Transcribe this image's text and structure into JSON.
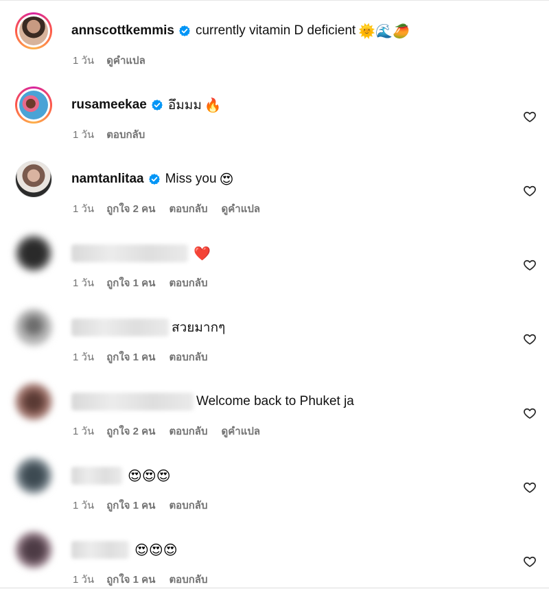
{
  "comments": [
    {
      "username": "annscottkemmis",
      "verified": true,
      "text": "currently vitamin D deficient",
      "emoji": "🌞🌊🥭",
      "time": "1 วัน",
      "likes": "",
      "reply": "",
      "translate": "ดูคำแปล",
      "has_heart": false
    },
    {
      "username": "rusameekae",
      "verified": true,
      "text": "อึมมม",
      "emoji": "🔥",
      "time": "1 วัน",
      "likes": "",
      "reply": "ตอบกลับ",
      "translate": "",
      "has_heart": true
    },
    {
      "username": "namtanlitaa",
      "verified": true,
      "text": "Miss you",
      "emoji": "😍",
      "time": "1 วัน",
      "likes": "ถูกใจ 2 คน",
      "reply": "ตอบกลับ",
      "translate": "ดูคำแปล",
      "has_heart": true
    },
    {
      "username": "",
      "verified": false,
      "text": "",
      "emoji": "❤️",
      "time": "1 วัน",
      "likes": "ถูกใจ 1 คน",
      "reply": "ตอบกลับ",
      "translate": "",
      "has_heart": true
    },
    {
      "username": "",
      "verified": false,
      "text": "สวยมากๆ",
      "emoji": "",
      "time": "1 วัน",
      "likes": "ถูกใจ 1 คน",
      "reply": "ตอบกลับ",
      "translate": "",
      "has_heart": true
    },
    {
      "username": "",
      "verified": false,
      "text": "Welcome back to Phuket ja",
      "emoji": "",
      "time": "1 วัน",
      "likes": "ถูกใจ 2 คน",
      "reply": "ตอบกลับ",
      "translate": "ดูคำแปล",
      "has_heart": true
    },
    {
      "username": "",
      "verified": false,
      "text": "",
      "emoji": "😍😍😍",
      "time": "1 วัน",
      "likes": "ถูกใจ 1 คน",
      "reply": "ตอบกลับ",
      "translate": "",
      "has_heart": true
    },
    {
      "username": "",
      "verified": false,
      "text": "",
      "emoji": "😍😍😍",
      "time": "1 วัน",
      "likes": "ถูกใจ 1 คน",
      "reply": "ตอบกลับ",
      "translate": "",
      "has_heart": true
    }
  ],
  "icons": {
    "verified": "verified-badge-icon",
    "like": "heart-outline-icon"
  },
  "colors": {
    "verified_blue": "#0095f6",
    "meta_gray": "#737373",
    "story_ring_start": "#d6249f",
    "story_ring_end": "#fdb24c"
  }
}
